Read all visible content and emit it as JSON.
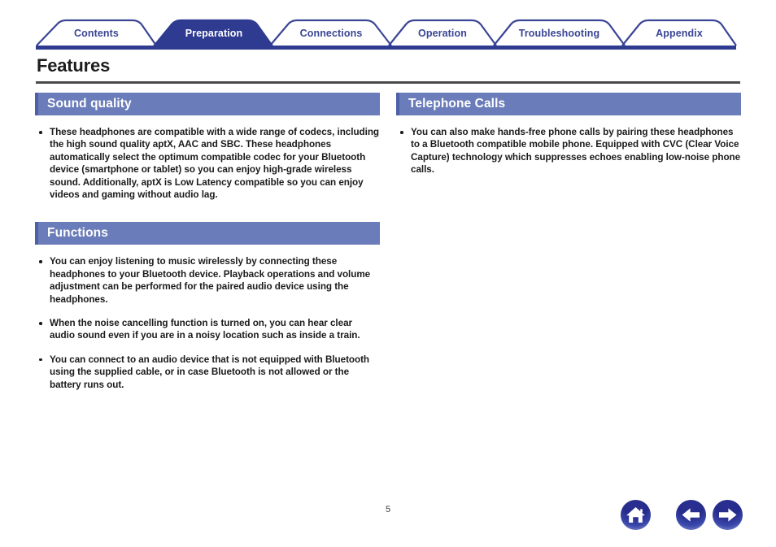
{
  "tabs": [
    {
      "label": "Contents",
      "active": false
    },
    {
      "label": "Preparation",
      "active": true
    },
    {
      "label": "Connections",
      "active": false
    },
    {
      "label": "Operation",
      "active": false
    },
    {
      "label": "Troubleshooting",
      "active": false
    },
    {
      "label": "Appendix",
      "active": false
    }
  ],
  "page": {
    "title": "Features",
    "number": "5"
  },
  "colors": {
    "tab_navy": "#3a4595",
    "section_header_bg": "#6a7cb9",
    "section_header_accent": "#4d61a8",
    "rule_gray": "#4a4a4a",
    "body_text": "#1b1b1b"
  },
  "columns": {
    "left": [
      {
        "heading": "Sound quality",
        "bullets": [
          "These headphones are compatible with a wide range of codecs, including the high sound quality aptX, AAC and SBC. These headphones automatically select the optimum compatible codec for your Bluetooth device (smartphone or tablet) so you can enjoy high-grade wireless sound. Additionally, aptX is Low Latency compatible so you can enjoy videos and gaming without audio lag."
        ]
      },
      {
        "heading": "Functions",
        "bullets": [
          "You can enjoy listening to music wirelessly by connecting these headphones to your Bluetooth device. Playback operations and volume adjustment can be performed for the paired audio device using the headphones.",
          "When the noise cancelling function is turned on, you can hear clear audio sound even if you are in a noisy location such as inside a train.",
          "You can connect to an audio device that is not equipped with Bluetooth using the supplied cable, or in case Bluetooth is not allowed or the battery runs out."
        ]
      }
    ],
    "right": [
      {
        "heading": "Telephone Calls",
        "bullets": [
          "You can also make hands-free phone calls by pairing these headphones to a Bluetooth compatible mobile phone. Equipped with CVC (Clear Voice Capture) technology which suppresses echoes enabling low-noise phone calls."
        ]
      }
    ]
  },
  "footer_nav": [
    {
      "name": "home-button",
      "icon": "home-icon"
    },
    {
      "name": "back-button",
      "icon": "arrow-left-icon"
    },
    {
      "name": "forward-button",
      "icon": "arrow-right-icon"
    }
  ]
}
